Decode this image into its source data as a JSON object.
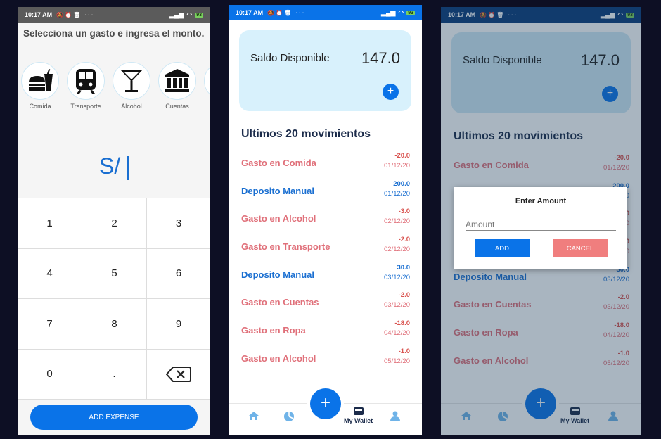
{
  "status_bar": {
    "time": "10:17 AM",
    "battery": "93"
  },
  "expense_screen": {
    "title": "Selecciona un gasto e ingresa el monto.",
    "categories": [
      {
        "label": "Comida",
        "icon": "fastfood-icon"
      },
      {
        "label": "Transporte",
        "icon": "train-icon"
      },
      {
        "label": "Alcohol",
        "icon": "cocktail-icon"
      },
      {
        "label": "Cuentas",
        "icon": "bank-icon"
      }
    ],
    "currency_prefix": "S/",
    "keys": [
      "1",
      "2",
      "3",
      "4",
      "5",
      "6",
      "7",
      "8",
      "9",
      "0",
      "."
    ],
    "backspace_icon": "backspace-icon",
    "add_expense_label": "ADD EXPENSE"
  },
  "wallet": {
    "balance_label": "Saldo Disponible",
    "balance_value": "147.0",
    "movements_title": "Ultimos 20 movimientos",
    "movements": [
      {
        "name": "Gasto en Comida",
        "amount": "-20.0",
        "date": "01/12/20",
        "type": "neg"
      },
      {
        "name": "Deposito Manual",
        "amount": "200.0",
        "date": "01/12/20",
        "type": "pos"
      },
      {
        "name": "Gasto en Alcohol",
        "amount": "-3.0",
        "date": "02/12/20",
        "type": "neg"
      },
      {
        "name": "Gasto en Transporte",
        "amount": "-2.0",
        "date": "02/12/20",
        "type": "neg"
      },
      {
        "name": "Deposito Manual",
        "amount": "30.0",
        "date": "03/12/20",
        "type": "pos"
      },
      {
        "name": "Gasto en Cuentas",
        "amount": "-2.0",
        "date": "03/12/20",
        "type": "neg"
      },
      {
        "name": "Gasto en Ropa",
        "amount": "-18.0",
        "date": "04/12/20",
        "type": "neg"
      },
      {
        "name": "Gasto en Alcohol",
        "amount": "-1.0",
        "date": "05/12/20",
        "type": "neg"
      }
    ],
    "nav": {
      "wallet_label": "My Wallet"
    }
  },
  "dialog": {
    "title": "Enter Amount",
    "placeholder": "Amount",
    "add_label": "ADD",
    "cancel_label": "CANCEL"
  },
  "colors": {
    "primary": "#0a73e8",
    "expense": "#e0707a",
    "deposit": "#1a6fd1",
    "balance_card": "#d8f1fc",
    "cancel": "#f07e7e"
  }
}
